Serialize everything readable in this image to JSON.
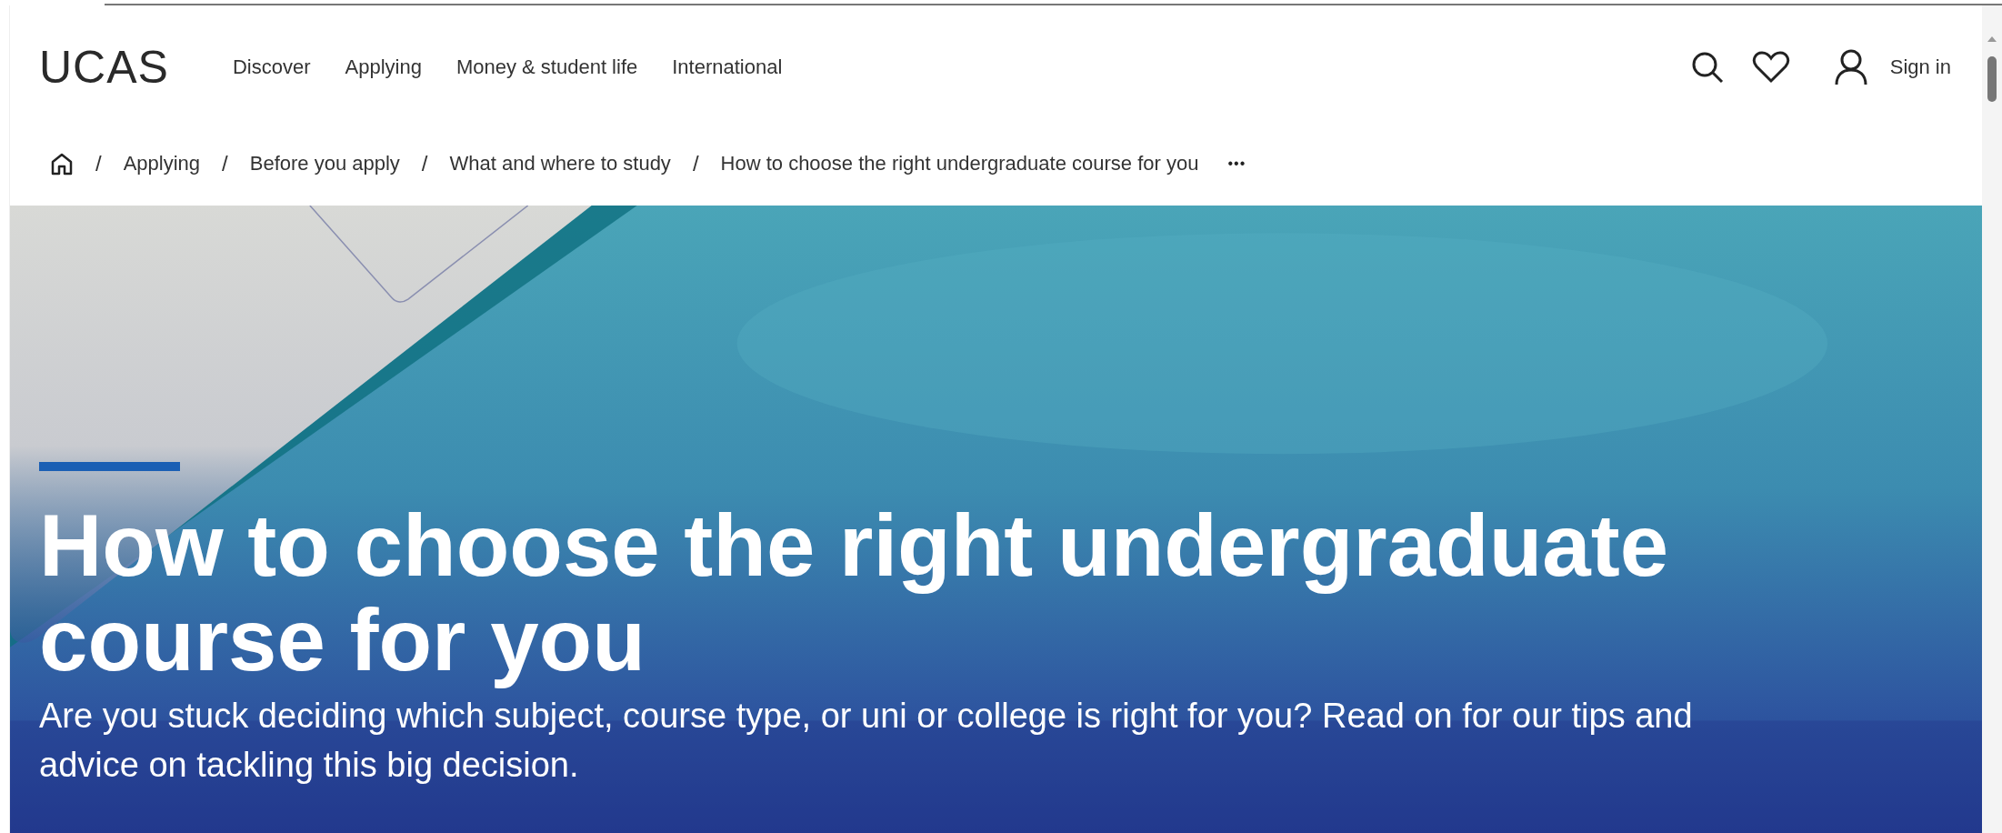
{
  "header": {
    "logo": "UCAS",
    "nav": [
      "Discover",
      "Applying",
      "Money & student life",
      "International"
    ],
    "sign_in": "Sign in"
  },
  "breadcrumb": {
    "items": [
      "Applying",
      "Before you apply",
      "What and where to study",
      "How to choose the right undergraduate course for you"
    ],
    "separator": "/",
    "more": "•••"
  },
  "hero": {
    "kind": "picture",
    "title": "How to choose the right undergraduate course for you",
    "subtitle": "Are you stuck deciding which subject, course type, or uni or college is right for you? Read on for our tips and advice on tackling this big decision."
  }
}
